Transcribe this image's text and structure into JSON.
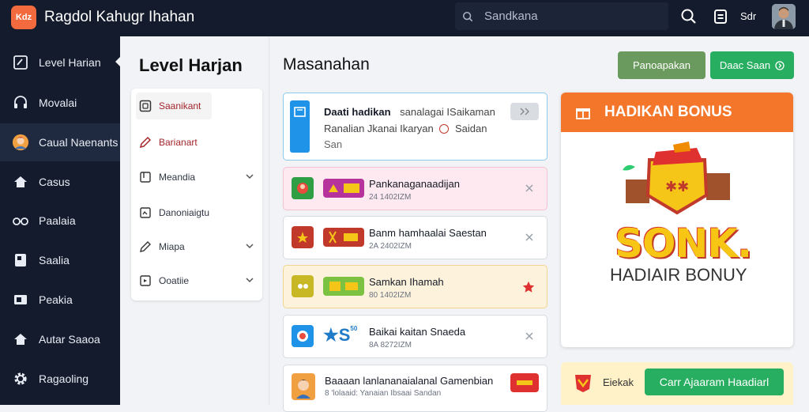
{
  "app": {
    "logo_text": "Kdz",
    "title": "Ragdol Kahugr Ihahan"
  },
  "search": {
    "value": "Sandkana"
  },
  "header": {
    "label": "Sdr"
  },
  "sidebar": {
    "items": [
      {
        "label": "Level Harian",
        "icon": "square-check-icon"
      },
      {
        "label": "Movalai",
        "icon": "headset-icon"
      },
      {
        "label": "Caual Naenants",
        "icon": "avatar-icon"
      },
      {
        "label": "Casus",
        "icon": "home-icon"
      },
      {
        "label": "Paalaia",
        "icon": "glasses-icon"
      },
      {
        "label": "Saalia",
        "icon": "phone-icon"
      },
      {
        "label": "Peakia",
        "icon": "film-icon"
      },
      {
        "label": "Autar Saaoa",
        "icon": "home-icon"
      },
      {
        "label": "Ragaoling",
        "icon": "gear-icon"
      }
    ]
  },
  "nav": {
    "title": "Level Harjan",
    "items": [
      {
        "label": "Saanikant",
        "icon": "box-icon"
      },
      {
        "label": "Barianart",
        "icon": "pen-icon"
      },
      {
        "label": "Meandia",
        "icon": "folder-icon"
      },
      {
        "label": "Danoniaigtu",
        "icon": "image-icon"
      },
      {
        "label": "Miapa",
        "icon": "pencil-icon"
      },
      {
        "label": "Ooatiie",
        "icon": "square-icon"
      }
    ]
  },
  "main": {
    "title": "Masanahan",
    "btn_primary": "Panoapakan",
    "btn_secondary": "Daac Saan"
  },
  "messages": [
    {
      "title": "Daati hadikan",
      "line1_rest": "sanalagai ISaikaman",
      "line2": "Ranalian Jkanai  Ikaryan",
      "line2_end": "Saidan",
      "line3": "San",
      "time": ""
    },
    {
      "title": "Pankanaganaadijan",
      "time": "24 1402IZM"
    },
    {
      "title": "Banm hamhaalai Saestan",
      "time": "2A 2402IZM"
    },
    {
      "title": "Samkan Ihamah",
      "time": "80 1402IZM"
    },
    {
      "title": "Baikai kaitan Snaeda",
      "time": "8A 8272IZM"
    },
    {
      "title": "Baaaan  lanlananaialanal Gamenbian",
      "time": "8 'lolaaid:  Yanaian Ibsaai  Sandan"
    }
  ],
  "bonus": {
    "head": "HADIKAN BONUS",
    "big": "SONK.",
    "sub": "HADIAIR BONUY"
  },
  "bottom": {
    "label": "Eiekak",
    "button": "Carr Ajaaram Haadiarl"
  },
  "colors": {
    "accent_green": "#27ae60",
    "orange": "#f4762b",
    "sidebar": "#141b2d"
  }
}
